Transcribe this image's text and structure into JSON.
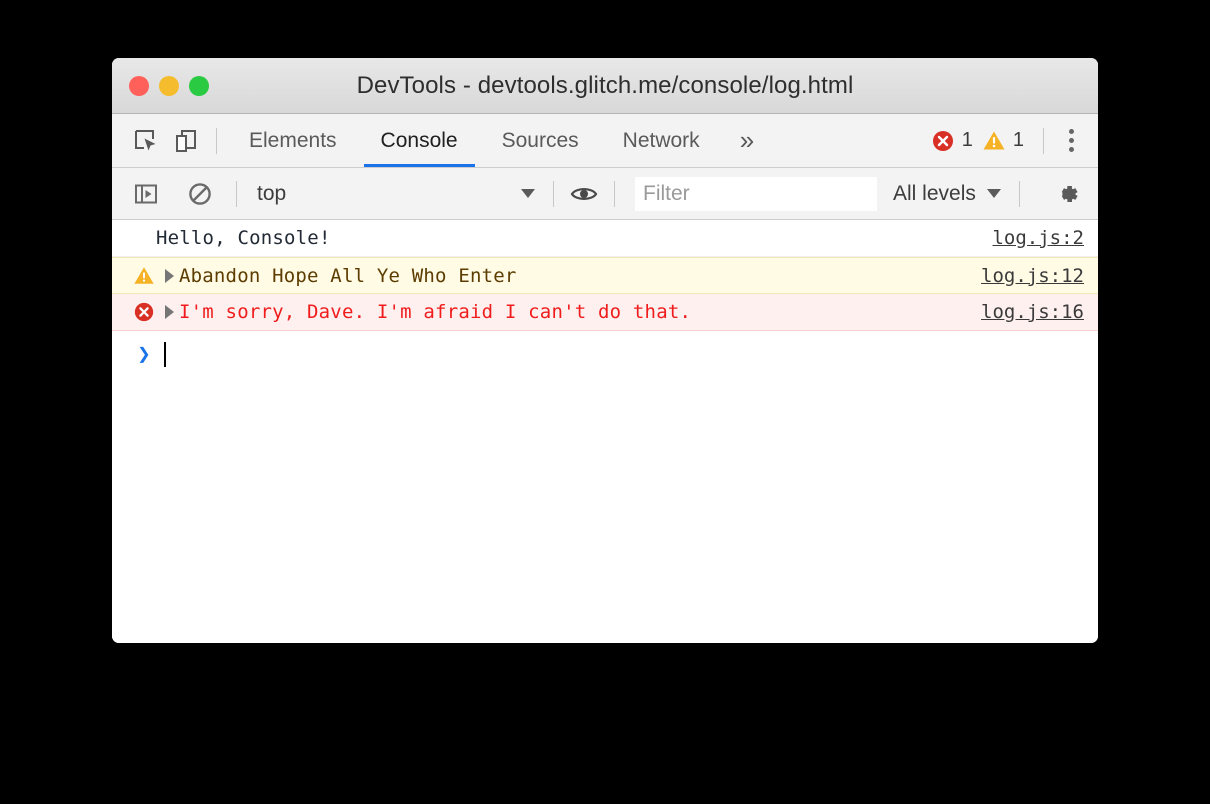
{
  "window": {
    "title": "DevTools - devtools.glitch.me/console/log.html",
    "traffic_lights": [
      {
        "name": "close",
        "color": "#ff6059"
      },
      {
        "name": "minimize",
        "color": "#f5bd2e"
      },
      {
        "name": "zoom",
        "color": "#2acb42"
      }
    ]
  },
  "tabbar": {
    "icons": [
      {
        "name": "inspect-element-icon",
        "label": "Inspect element"
      },
      {
        "name": "device-toolbar-icon",
        "label": "Toggle device toolbar"
      }
    ],
    "tabs": [
      {
        "label": "Elements",
        "active": false
      },
      {
        "label": "Console",
        "active": true
      },
      {
        "label": "Sources",
        "active": false
      },
      {
        "label": "Network",
        "active": false
      }
    ],
    "overflow_label": "»",
    "error_count": "1",
    "warning_count": "1",
    "menu_label": "Customize and control DevTools",
    "accent_color": "#1a73e8",
    "error_color": "#d93025",
    "warning_color": "#f5b225"
  },
  "console_toolbar": {
    "sidebar_toggle_label": "Show console sidebar",
    "clear_label": "Clear console",
    "context": "top",
    "eye_label": "Create live expression",
    "filter": {
      "value": "",
      "placeholder": "Filter"
    },
    "levels": "All levels",
    "settings_label": "Console settings"
  },
  "console_messages": [
    {
      "type": "log",
      "icon": "",
      "expandable": false,
      "text": "Hello, Console!",
      "source": "log.js:2"
    },
    {
      "type": "warn",
      "icon": "warning-icon",
      "expandable": true,
      "text": "Abandon Hope All Ye Who Enter",
      "source": "log.js:12"
    },
    {
      "type": "err",
      "icon": "error-icon",
      "expandable": true,
      "text": "I'm sorry, Dave. I'm afraid I can't do that.",
      "source": "log.js:16"
    }
  ],
  "prompt": {
    "arrow": "❯",
    "value": ""
  }
}
